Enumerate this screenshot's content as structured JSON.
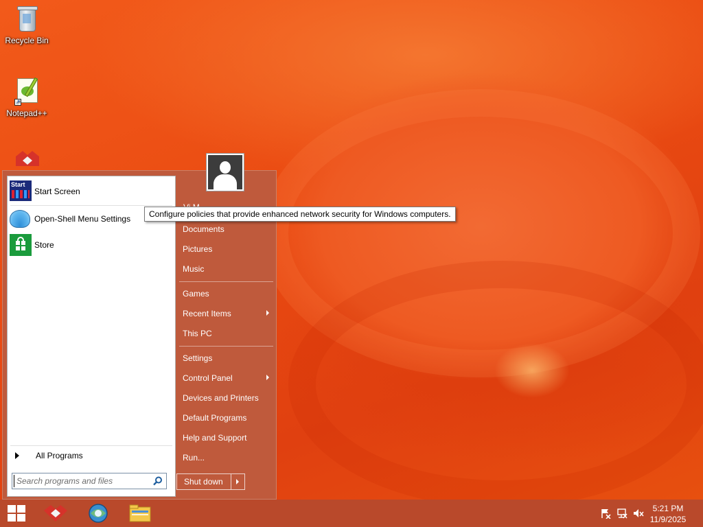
{
  "desktop": {
    "icons": [
      {
        "label": "Recycle Bin"
      },
      {
        "label": "Notepad++"
      }
    ]
  },
  "start_menu": {
    "pinned": [
      {
        "label": "Start Screen",
        "tile_text": "Start"
      },
      {
        "label": "Open-Shell Menu Settings"
      },
      {
        "label": "Store"
      }
    ],
    "all_programs_label": "All Programs",
    "search_placeholder": "Search programs and files",
    "user_name_partial": "Vi M",
    "right_items_group1": [
      "Documents",
      "Pictures",
      "Music"
    ],
    "right_items_group2": [
      "Games",
      "Recent Items",
      "This PC"
    ],
    "right_items_group3": [
      "Settings",
      "Control Panel",
      "Devices and Printers",
      "Default Programs",
      "Help and Support",
      "Run..."
    ],
    "shutdown_label": "Shut down"
  },
  "tooltip": {
    "text": "Configure policies that provide enhanced network security for Windows computers."
  },
  "taskbar": {
    "clock_time": "5:21 PM",
    "clock_date": "11/9/2025"
  },
  "colors": {
    "accent": "#bf5a3c",
    "taskbar": "#b9492b",
    "wallpaper": "#e84a12"
  }
}
